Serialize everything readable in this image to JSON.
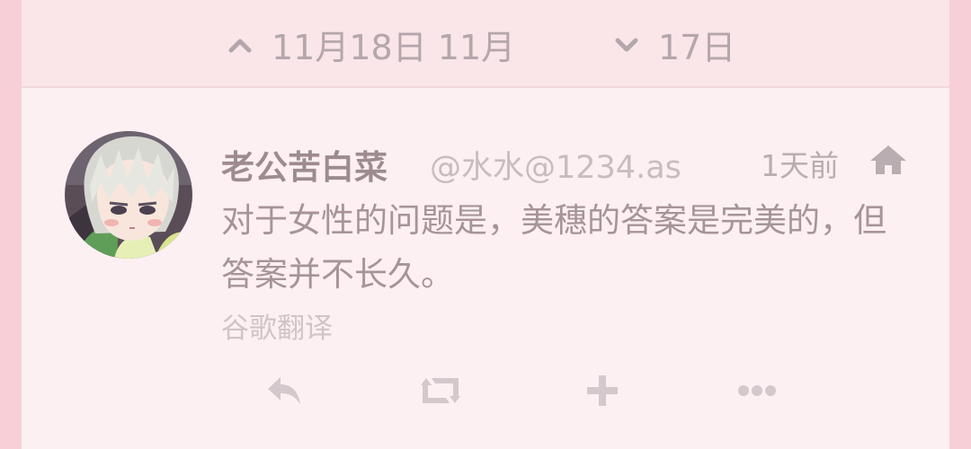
{
  "date_bar": {
    "earlier_label": "11月18日 11月",
    "later_label": "17日",
    "up_icon": "chevron-up-icon",
    "down_icon": "chevron-down-icon"
  },
  "tweet": {
    "author_name": "老公苦白菜",
    "handle": "@水水@1234.as",
    "timestamp": "1天前",
    "visibility_icon": "home-icon",
    "text": "对于女性的问题是，美穗的答案是完美的，但答案并不长久。",
    "translate_label": "谷歌翻译",
    "actions": [
      "reply-icon",
      "boost-icon",
      "favourite-plus-icon",
      "more-icon"
    ]
  },
  "colors": {
    "edge_pink": "#f7cfd6",
    "card_bg": "#fcf0f2",
    "header_bg": "#fae5e9",
    "name_text": "#9d8b90",
    "body_text": "#a79498",
    "muted_text": "#c9bcc0",
    "action_icon": "#d4c8cc"
  }
}
